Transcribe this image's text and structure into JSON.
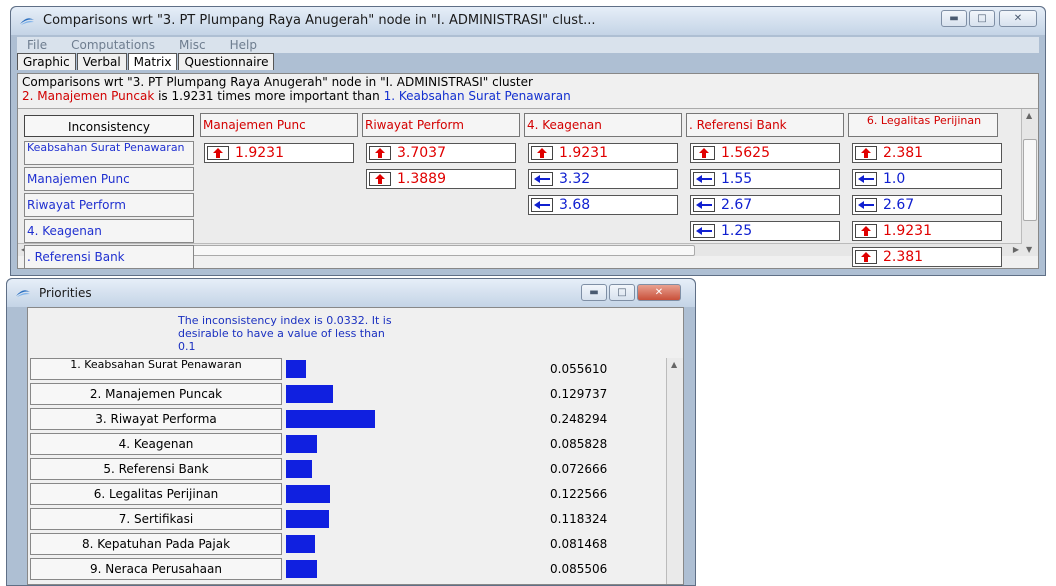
{
  "compare_window": {
    "title": "Comparisons wrt \"3. PT Plumpang Raya Anugerah\" node in \"I. ADMINISTRASI\" clust...",
    "menu": [
      "File",
      "Computations",
      "Misc",
      "Help"
    ],
    "tabs": [
      "Graphic",
      "Verbal",
      "Matrix",
      "Questionnaire"
    ],
    "info_line": "Comparisons wrt \"3. PT Plumpang Raya Anugerah\" node in \"I. ADMINISTRASI\" cluster",
    "info_red": "2. Manajemen Puncak",
    "info_mid": " is 1.9231 times more important than ",
    "info_blue": "1. Keabsahan Surat Penawaran",
    "inconsistency_label": "Inconsistency",
    "col_headers": [
      "Manajemen Punc",
      "Riwayat Perform",
      "4. Keagenan",
      ". Referensi Bank",
      "6. Legalitas Perijinan"
    ],
    "row_headers": [
      "Keabsahan Surat Penawaran",
      "Manajemen Punc",
      "Riwayat Perform",
      "4. Keagenan",
      ". Referensi Bank"
    ],
    "cells": [
      {
        "row": 0,
        "col": 0,
        "value": "1.9231",
        "dir": "up"
      },
      {
        "row": 0,
        "col": 1,
        "value": "3.7037",
        "dir": "up"
      },
      {
        "row": 0,
        "col": 2,
        "value": "1.9231",
        "dir": "up"
      },
      {
        "row": 0,
        "col": 3,
        "value": "1.5625",
        "dir": "up"
      },
      {
        "row": 0,
        "col": 4,
        "value": "2.381",
        "dir": "up"
      },
      {
        "row": 1,
        "col": 1,
        "value": "1.3889",
        "dir": "up"
      },
      {
        "row": 1,
        "col": 2,
        "value": "3.32",
        "dir": "left"
      },
      {
        "row": 1,
        "col": 3,
        "value": "1.55",
        "dir": "left"
      },
      {
        "row": 1,
        "col": 4,
        "value": "1.0",
        "dir": "left"
      },
      {
        "row": 2,
        "col": 2,
        "value": "3.68",
        "dir": "left"
      },
      {
        "row": 2,
        "col": 3,
        "value": "2.67",
        "dir": "left"
      },
      {
        "row": 2,
        "col": 4,
        "value": "2.67",
        "dir": "left"
      },
      {
        "row": 3,
        "col": 3,
        "value": "1.25",
        "dir": "left"
      },
      {
        "row": 3,
        "col": 4,
        "value": "1.9231",
        "dir": "up"
      },
      {
        "row": 4,
        "col": 4,
        "value": "2.381",
        "dir": "up"
      }
    ]
  },
  "priorities_window": {
    "title": "Priorities",
    "note": "The inconsistency index is 0.0332.  It is desirable to have a value of less than 0.1",
    "items": [
      {
        "label": "1. Keabsahan Surat Penawaran",
        "value": "0.055610",
        "fraction": 0.05561
      },
      {
        "label": "2. Manajemen Puncak",
        "value": "0.129737",
        "fraction": 0.129737
      },
      {
        "label": "3. Riwayat Performa",
        "value": "0.248294",
        "fraction": 0.248294
      },
      {
        "label": "4. Keagenan",
        "value": "0.085828",
        "fraction": 0.085828
      },
      {
        "label": "5. Referensi Bank",
        "value": "0.072666",
        "fraction": 0.072666
      },
      {
        "label": "6. Legalitas Perijinan",
        "value": "0.122566",
        "fraction": 0.122566
      },
      {
        "label": "7. Sertifikasi",
        "value": "0.118324",
        "fraction": 0.118324
      },
      {
        "label": "8. Kepatuhan Pada Pajak",
        "value": "0.081468",
        "fraction": 0.081468
      },
      {
        "label": "9. Neraca Perusahaan",
        "value": "0.085506",
        "fraction": 0.085506
      }
    ]
  },
  "colors": {
    "up_arrow": "#e00000",
    "left_arrow": "#1020d0",
    "bar": "#1020e0"
  }
}
